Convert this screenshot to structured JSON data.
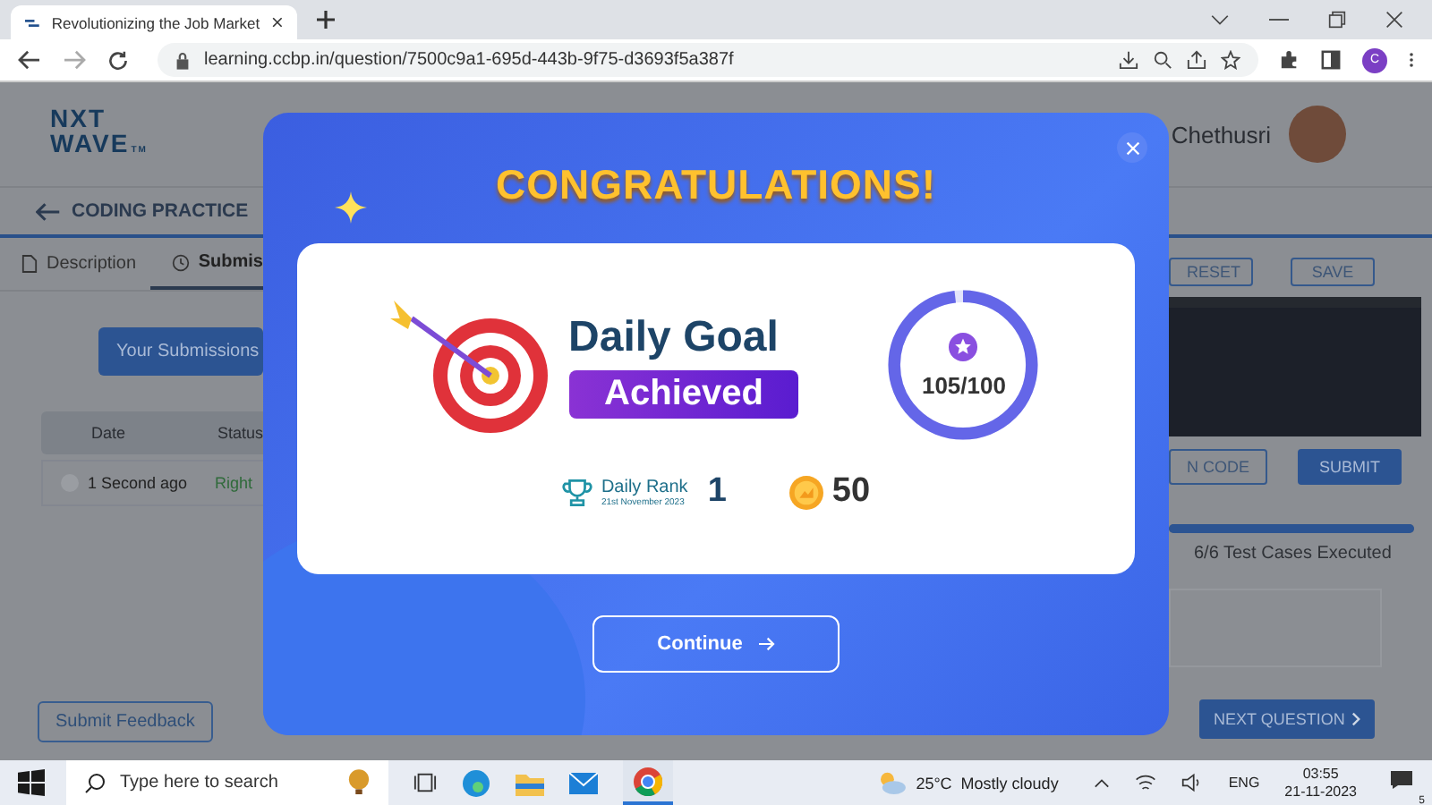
{
  "browser": {
    "tab_title": "Revolutionizing the Job Market",
    "url": "learning.ccbp.in/question/7500c9a1-695d-443b-9f75-d3693f5a387f",
    "profile_initial": "C"
  },
  "header": {
    "logo": [
      "NXT",
      "WAVE"
    ],
    "logo_mark": "TM",
    "user_name": "Chethusri"
  },
  "title": "CODING PRACTICE",
  "tabs": [
    {
      "label": "Description",
      "selected": false
    },
    {
      "label": "Submis",
      "selected": true
    }
  ],
  "submissions_button": "Your Submissions",
  "table": {
    "columns": [
      "Date",
      "Status"
    ],
    "rows": [
      {
        "date": "1 Second ago",
        "status": "Right"
      }
    ]
  },
  "feedback_button": "Submit Feedback",
  "editor_buttons": [
    "RESET",
    "SAVE"
  ],
  "run_buttons": [
    {
      "label": "N CODE",
      "kind": "outline"
    },
    {
      "label": "SUBMIT",
      "kind": "filled"
    }
  ],
  "test_progress": {
    "level": 1,
    "label": "6/6 Test Cases Executed"
  },
  "next_button": "NEXT QUESTION",
  "modal": {
    "title": "CONGRATULATIONS!",
    "goal_title": "Daily Goal",
    "goal_badge": "Achieved",
    "goal_ring": {
      "level": 0.98,
      "reading": "105/100"
    },
    "rank_label": "Daily Rank",
    "rank_date": "21st November 2023",
    "rank": "1",
    "coins": "50",
    "continue": "Continue"
  },
  "taskbar": {
    "search_placeholder": "Type here to search",
    "temperature": "25°C",
    "weather": "Mostly cloudy",
    "language": "ENG",
    "time": "03:55",
    "date": "21-11-2023",
    "notifications": "5"
  }
}
